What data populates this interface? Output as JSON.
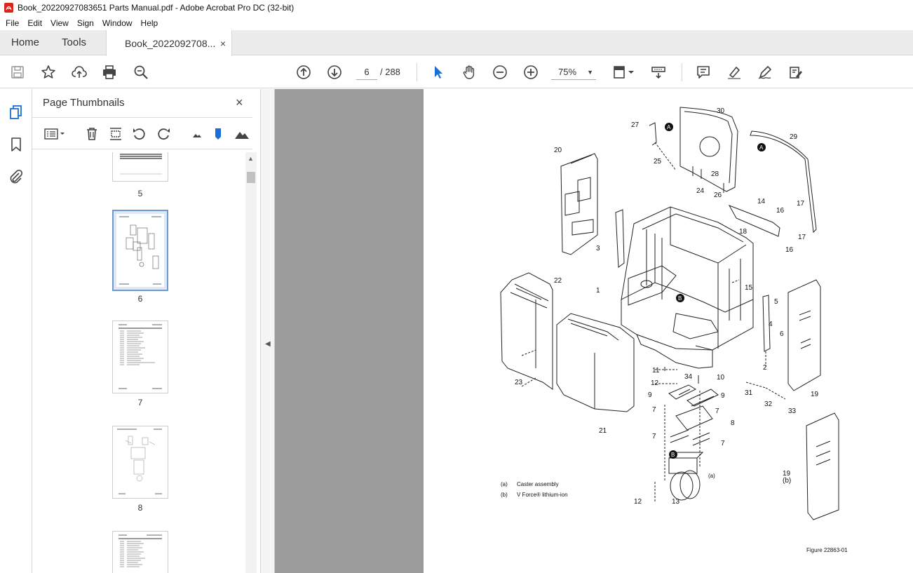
{
  "window": {
    "title": "Book_20220927083651 Parts Manual.pdf - Adobe Acrobat Pro DC (32-bit)"
  },
  "menu": [
    "File",
    "Edit",
    "View",
    "Sign",
    "Window",
    "Help"
  ],
  "tabs": {
    "home": "Home",
    "tools": "Tools",
    "document": "Book_2022092708...",
    "close": "×"
  },
  "toolbar": {
    "current_page": "6",
    "page_total": "/ 288",
    "zoom": "75%"
  },
  "thumbnails": {
    "title": "Page Thumbnails",
    "close": "×",
    "pages": [
      {
        "label": "5"
      },
      {
        "label": "6",
        "selected": true
      },
      {
        "label": "7"
      },
      {
        "label": "8"
      }
    ]
  },
  "figure": {
    "callouts": [
      "30",
      "27",
      "A",
      "A",
      "29",
      "20",
      "25",
      "28",
      "24",
      "26",
      "14",
      "16",
      "17",
      "18",
      "17",
      "16",
      "3",
      "1",
      "B",
      "15",
      "22",
      "5",
      "4",
      "6",
      "2",
      "11",
      "34",
      "10",
      "12",
      "9",
      "9",
      "7",
      "7",
      "8",
      "23",
      "31",
      "32",
      "33",
      "19",
      "21",
      "7",
      "7",
      "B",
      "12",
      "13",
      "19",
      "(b)",
      "(a)"
    ],
    "notes": [
      {
        "key": "(a)",
        "text": "Caster assembly"
      },
      {
        "key": "(b)",
        "text": "V Force® lithium-ion"
      }
    ],
    "figure_number": "Figure 22863-01"
  }
}
